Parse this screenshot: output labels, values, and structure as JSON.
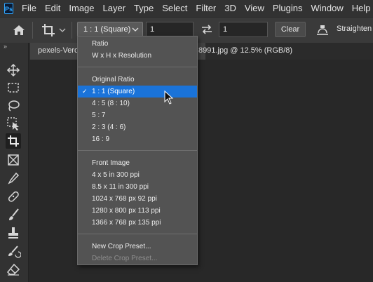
{
  "menubar": {
    "logo": "Ps",
    "items": [
      "File",
      "Edit",
      "Image",
      "Layer",
      "Type",
      "Select",
      "Filter",
      "3D",
      "View",
      "Plugins",
      "Window",
      "Help"
    ]
  },
  "options": {
    "ratio_value": "1 : 1 (Square)",
    "width_value": "1",
    "height_value": "1",
    "clear_label": "Clear",
    "straighten_label": "Straighten"
  },
  "toolpanel": {
    "collapse_label": "»",
    "tools": [
      "move-tool",
      "marquee-tool",
      "lasso-tool",
      "object-selection-tool",
      "crop-tool",
      "frame-tool",
      "eyedropper-tool",
      "healing-brush-tool",
      "brush-tool",
      "clone-stamp-tool",
      "history-brush-tool",
      "eraser-tool"
    ]
  },
  "document": {
    "tab_left": "pexels-Vero",
    "tab_right": "8991.jpg @ 12.5% (RGB/8)"
  },
  "dropdown": {
    "items": [
      {
        "label": "Ratio",
        "state": "normal"
      },
      {
        "label": "W x H x Resolution",
        "state": "normal"
      },
      {
        "label": "---"
      },
      {
        "label": "Original Ratio",
        "state": "normal"
      },
      {
        "label": "1 : 1 (Square)",
        "state": "selected"
      },
      {
        "label": "4 : 5 (8 : 10)",
        "state": "normal"
      },
      {
        "label": "5 : 7",
        "state": "normal"
      },
      {
        "label": "2 : 3 (4 : 6)",
        "state": "normal"
      },
      {
        "label": "16 : 9",
        "state": "normal"
      },
      {
        "label": "---"
      },
      {
        "label": "Front Image",
        "state": "normal"
      },
      {
        "label": "4 x 5 in 300 ppi",
        "state": "normal"
      },
      {
        "label": "8.5 x 11 in 300 ppi",
        "state": "normal"
      },
      {
        "label": "1024 x 768 px 92 ppi",
        "state": "normal"
      },
      {
        "label": "1280 x 800 px 113 ppi",
        "state": "normal"
      },
      {
        "label": "1366 x 768 px 135 ppi",
        "state": "normal"
      },
      {
        "label": "---"
      },
      {
        "label": "New Crop Preset...",
        "state": "normal"
      },
      {
        "label": "Delete Crop Preset...",
        "state": "disabled"
      }
    ],
    "check_glyph": "✓"
  },
  "colors": {
    "selection": "#1a73d9",
    "ps_brand": "#31a8ff"
  }
}
